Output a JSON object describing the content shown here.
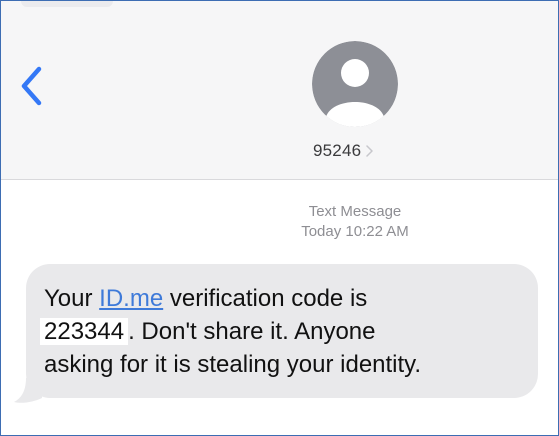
{
  "contact": {
    "number": "95246"
  },
  "thread": {
    "service_label": "Text Message",
    "timestamp": "Today 10:22 AM"
  },
  "message": {
    "prefix": "Your ",
    "link_text": "ID.me",
    "after_link": " verification code is",
    "code": "223344",
    "after_code": ". Don't share it. Anyone",
    "line3": "asking for it is stealing your identity."
  },
  "colors": {
    "accent": "#3478f6",
    "bubble": "#e9e9eb",
    "link": "#3e7ad9",
    "header_bg": "#f6f6f7"
  },
  "icons": {
    "back": "chevron-left-icon",
    "avatar": "person-avatar-icon",
    "contact_details": "chevron-right-icon"
  }
}
